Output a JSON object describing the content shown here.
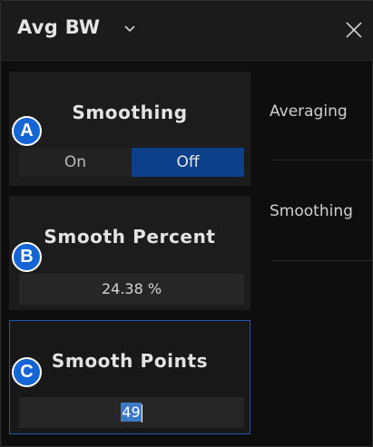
{
  "header": {
    "title": "Avg BW",
    "dropdown_icon": "chevron-down-icon",
    "close_icon": "close-icon"
  },
  "cards": {
    "smoothing": {
      "title": "Smoothing",
      "options": [
        "On",
        "Off"
      ],
      "selected": "Off"
    },
    "smooth_percent": {
      "title": "Smooth Percent",
      "value": "24.38 %"
    },
    "smooth_points": {
      "title": "Smooth Points",
      "value": "49"
    }
  },
  "side_menu": {
    "items": [
      "Averaging",
      "Smoothing"
    ]
  },
  "markers": [
    "A",
    "B",
    "C"
  ],
  "colors": {
    "accent": "#0c3f8a",
    "marker": "#1565d6",
    "selection": "#3d7ac4"
  }
}
